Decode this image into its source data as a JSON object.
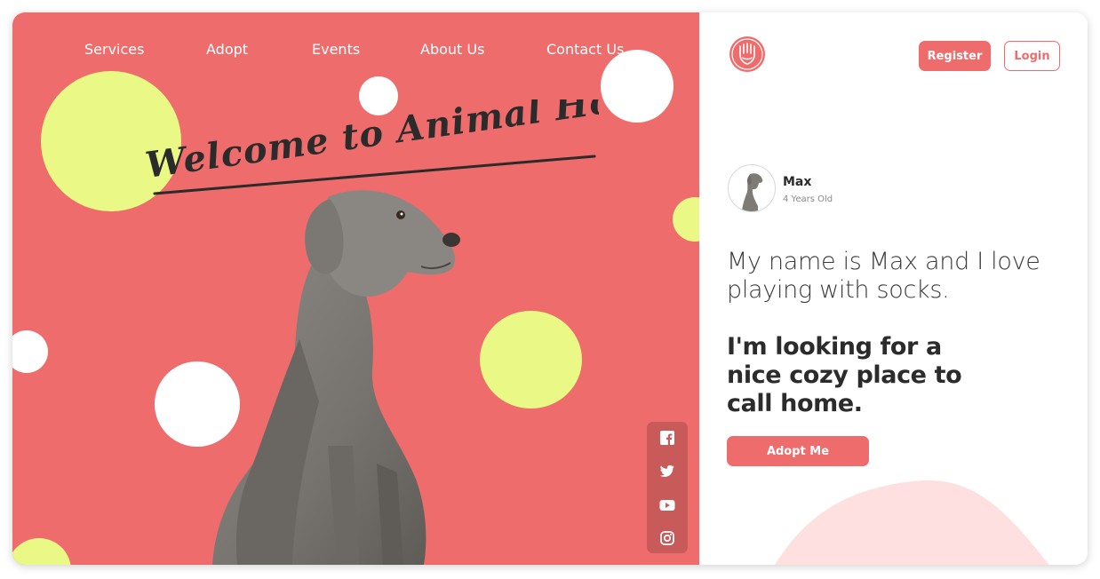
{
  "nav": {
    "items": [
      "Services",
      "Adopt",
      "Events",
      "About Us",
      "Contact Us"
    ]
  },
  "hero": {
    "welcome_text": "Welcome to Animal House!"
  },
  "header": {
    "register_label": "Register",
    "login_label": "Login"
  },
  "pet": {
    "name": "Max",
    "age": "4 Years Old",
    "intro": "My name is Max and I love playing with socks.",
    "headline": "I'm looking for a nice cozy place to call home.",
    "adopt_label": "Adopt Me"
  },
  "social": {
    "icons": [
      "facebook-icon",
      "twitter-icon",
      "youtube-icon",
      "instagram-icon"
    ]
  },
  "colors": {
    "brand": "#ee6c6b",
    "accent_yellow": "#eaf885",
    "social_bar": "#c85a59",
    "blob": "#fde0df"
  }
}
